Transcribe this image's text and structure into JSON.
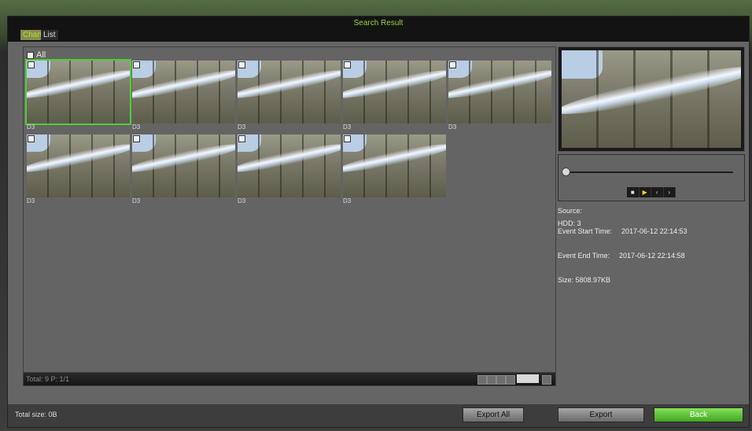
{
  "window": {
    "title": "Search Result"
  },
  "tabs": [
    {
      "label": "Chart"
    },
    {
      "label": "List"
    }
  ],
  "thumbs": {
    "select_all_label": "All",
    "items": [
      {
        "label": "D3"
      },
      {
        "label": "D3"
      },
      {
        "label": "D3"
      },
      {
        "label": "D3"
      },
      {
        "label": "D3"
      },
      {
        "label": "D3"
      },
      {
        "label": "D3"
      },
      {
        "label": "D3"
      },
      {
        "label": "D3"
      }
    ]
  },
  "pager": {
    "text": "Total: 9  P: 1/1"
  },
  "playback": {
    "controls": [
      "■",
      "▶",
      "‹",
      "›"
    ],
    "position": 0
  },
  "details": {
    "source_label": "Source:",
    "hdd": "HDD: 3",
    "start_label": "Event Start Time:",
    "start_value": "2017-06-12 22:14:53",
    "end_label": "Event End Time:",
    "end_value": "2017-06-12 22:14:58",
    "size": "Size: 5808.97KB"
  },
  "footer": {
    "total_size": "Total size: 0B",
    "export_all": "Export All",
    "export": "Export",
    "back": "Back"
  },
  "colors": {
    "accent": "#9fd23c",
    "selection": "#4fcf35",
    "back_button": "#3fa71f"
  }
}
